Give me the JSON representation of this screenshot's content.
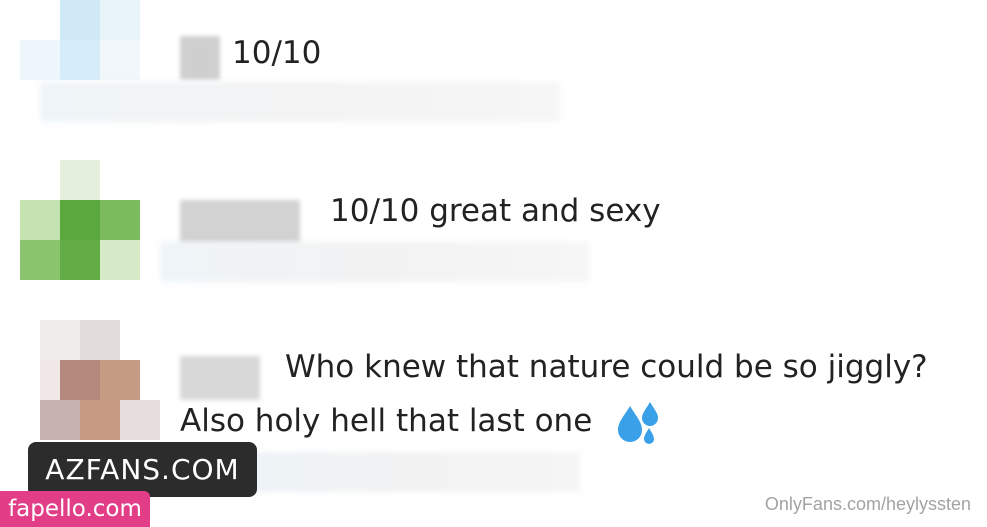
{
  "comments": [
    {
      "text": "10/10"
    },
    {
      "text": "10/10 great and sexy"
    },
    {
      "text_line1": "Who knew that nature could be so jiggly?",
      "text_line2": "Also holy hell that last one",
      "emoji": "sweat-droplets-icon"
    }
  ],
  "overlays": {
    "azfans": "AZFANS.COM",
    "fapello": "fapello.com",
    "watermark": "OnlyFans.com/heylyssten"
  },
  "colors": {
    "text": "#222222",
    "fapello_bg": "#e23d87",
    "azfans_bg": "#2c2c2c",
    "watermark": "#a3a3a3",
    "emoji": "#3aa0e8"
  }
}
